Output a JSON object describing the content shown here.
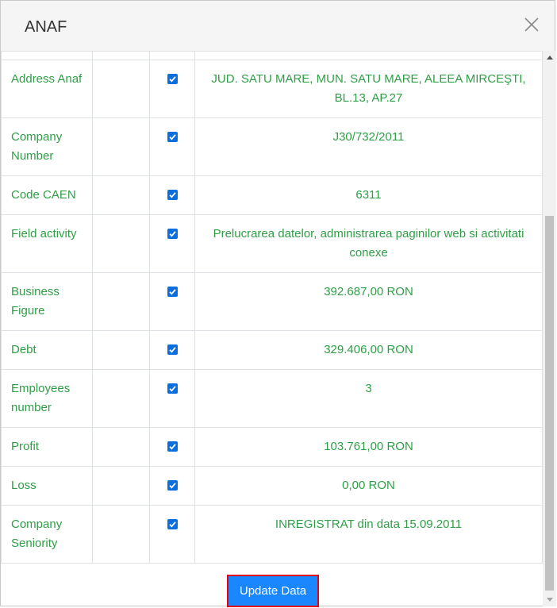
{
  "modal": {
    "title": "ANAF",
    "update_button_label": "Update Data"
  },
  "rows": [
    {
      "label": "Address Anaf",
      "value": "JUD. SATU MARE, MUN. SATU MARE, ALEEA MIRCEŞTI, BL.13, AP.27",
      "checked": true
    },
    {
      "label": "Company Number",
      "value": "J30/732/2011",
      "checked": true
    },
    {
      "label": "Code CAEN",
      "value": "6311",
      "checked": true
    },
    {
      "label": "Field activity",
      "value": "Prelucrarea datelor, administrarea paginilor web si activitati conexe",
      "checked": true
    },
    {
      "label": "Business Figure",
      "value": "392.687,00 RON",
      "checked": true
    },
    {
      "label": "Debt",
      "value": "329.406,00 RON",
      "checked": true
    },
    {
      "label": "Employees number",
      "value": "3",
      "checked": true
    },
    {
      "label": "Profit",
      "value": "103.761,00 RON",
      "checked": true
    },
    {
      "label": "Loss",
      "value": "0,00 RON",
      "checked": true
    },
    {
      "label": "Company Seniority",
      "value": "INREGISTRAT din data 15.09.2011",
      "checked": true
    }
  ],
  "colors": {
    "label_text": "#2e9f46",
    "checkbox": "#0b6ede",
    "button_bg": "#1a86ff",
    "button_border": "#e30613"
  }
}
